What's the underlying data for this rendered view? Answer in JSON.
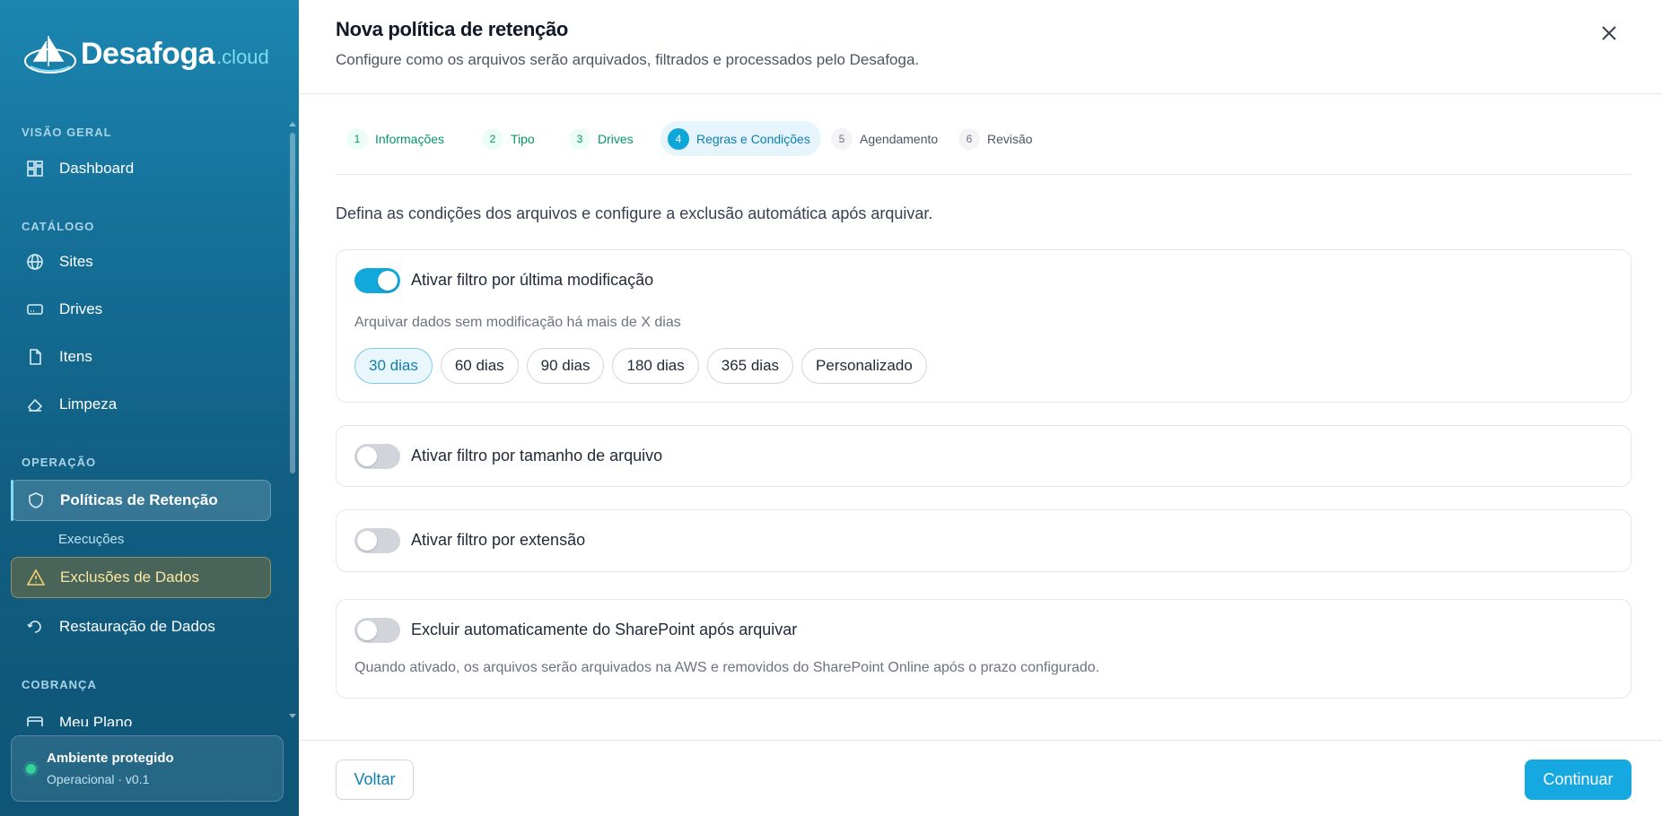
{
  "app": {
    "name": "Desafoga",
    "name_suffix": ".cloud"
  },
  "sidebar": {
    "sections": [
      {
        "label": "VISÃO GERAL"
      },
      {
        "label": "CATÁLOGO"
      },
      {
        "label": "OPERAÇÃO"
      },
      {
        "label": "COBRANÇA"
      }
    ],
    "items": [
      {
        "label": "Dashboard",
        "icon": "dashboard-icon"
      },
      {
        "label": "Sites",
        "icon": "globe-icon"
      },
      {
        "label": "Drives",
        "icon": "drive-icon"
      },
      {
        "label": "Itens",
        "icon": "file-icon"
      },
      {
        "label": "Limpeza",
        "icon": "eraser-icon"
      },
      {
        "label": "Políticas de Retenção",
        "icon": "shield-icon",
        "active": true
      },
      {
        "label": "Execuções",
        "sub": true
      },
      {
        "label": "Exclusões de Dados",
        "icon": "warning-icon",
        "highlight": "warning"
      },
      {
        "label": "Restauração de Dados",
        "icon": "restore-icon"
      },
      {
        "label": "Meu Plano",
        "icon": "card-icon"
      }
    ],
    "status": {
      "title": "Ambiente protegido",
      "subtitle": "Operacional · v0.1",
      "color": "#34d399"
    }
  },
  "header": {
    "title": "Nova política de retenção",
    "subtitle": "Configure como os arquivos serão arquivados, filtrados e processados pelo Desafoga."
  },
  "steps": [
    {
      "number": "1",
      "label": "Informações",
      "state": "done"
    },
    {
      "number": "2",
      "label": "Tipo",
      "state": "done"
    },
    {
      "number": "3",
      "label": "Drives",
      "state": "done"
    },
    {
      "number": "4",
      "label": "Regras e Condições",
      "state": "current"
    },
    {
      "number": "5",
      "label": "Agendamento",
      "state": "pending"
    },
    {
      "number": "6",
      "label": "Revisão",
      "state": "pending"
    }
  ],
  "intro": "Defina as condições dos arquivos e configure a exclusão automática após arquivar.",
  "filters": {
    "modified": {
      "label": "Ativar filtro por última modificação",
      "enabled": true,
      "hint": "Arquivar dados sem modificação há mais de X dias",
      "options": [
        "30 dias",
        "60 dias",
        "90 dias",
        "180 dias",
        "365 dias",
        "Personalizado"
      ],
      "selected": "30 dias"
    },
    "size": {
      "label": "Ativar filtro por tamanho de arquivo",
      "enabled": false
    },
    "extension": {
      "label": "Ativar filtro por extensão",
      "enabled": false
    },
    "auto_delete": {
      "label": "Excluir automaticamente do SharePoint após arquivar",
      "enabled": false,
      "hint": "Quando ativado, os arquivos serão arquivados na AWS e removidos do SharePoint Online após o prazo configurado."
    }
  },
  "footer": {
    "back_label": "Voltar",
    "next_label": "Continuar"
  },
  "colors": {
    "accent": "#16a8e0",
    "done": "#059669",
    "warning": "#f5d36b"
  }
}
